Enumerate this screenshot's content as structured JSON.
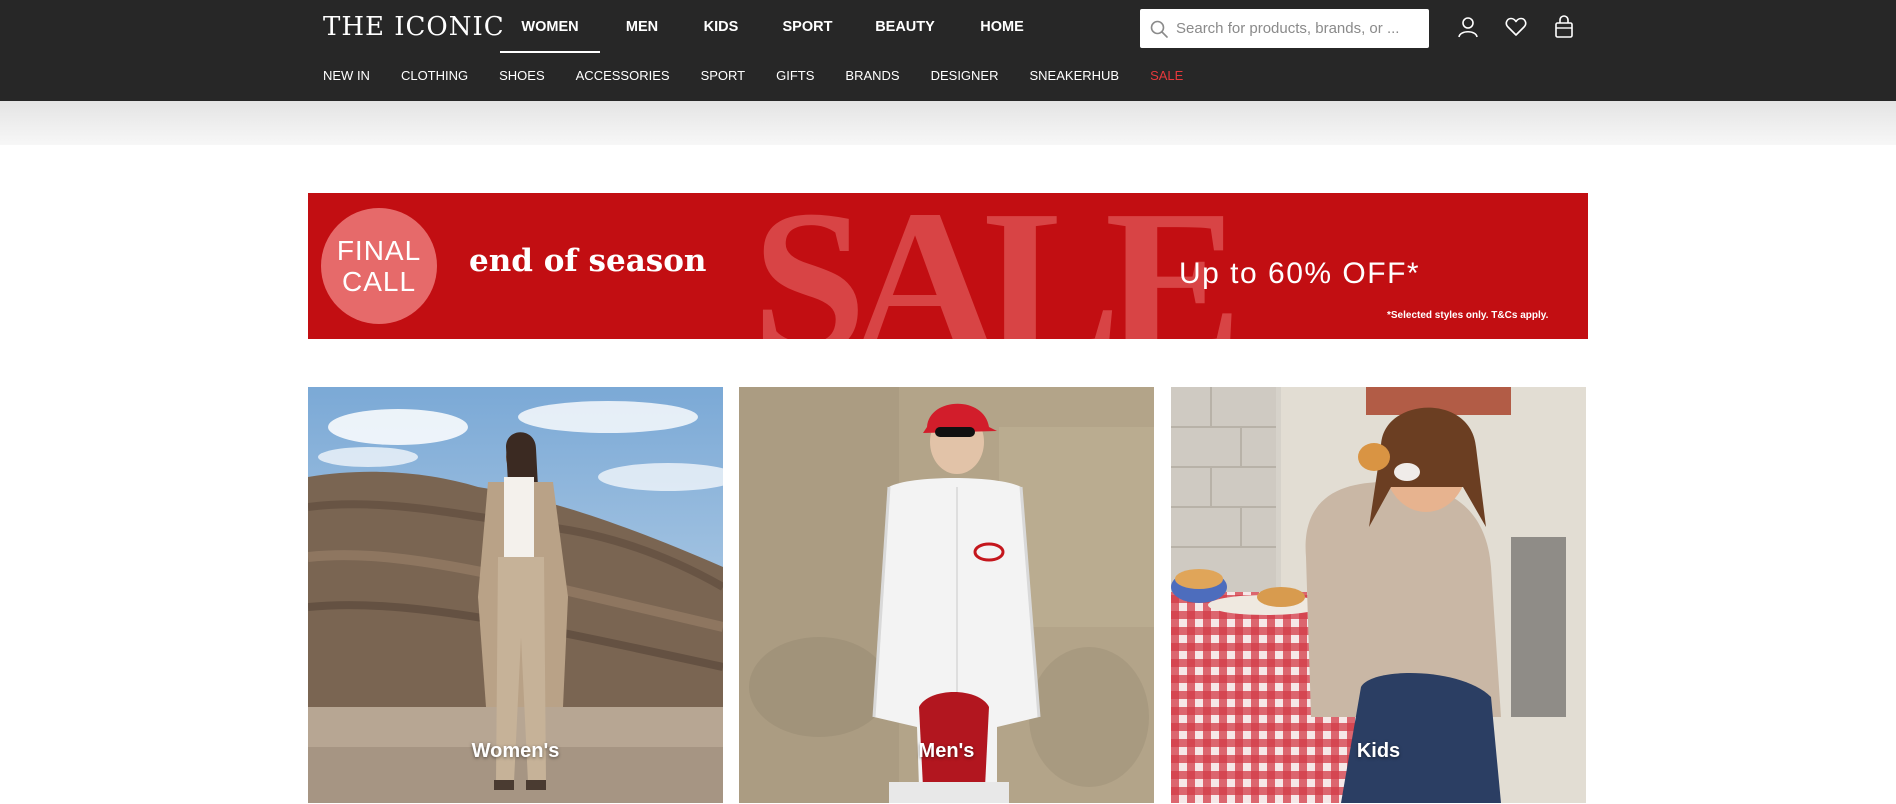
{
  "header": {
    "logo": "THE ICONIC",
    "tabs": [
      {
        "label": "WOMEN",
        "active": true
      },
      {
        "label": "MEN",
        "active": false
      },
      {
        "label": "KIDS",
        "active": false
      },
      {
        "label": "SPORT",
        "active": false
      },
      {
        "label": "BEAUTY",
        "active": false
      },
      {
        "label": "HOME",
        "active": false
      }
    ],
    "search": {
      "placeholder": "Search for products, brands, or ..."
    },
    "icons": [
      "account-icon",
      "wishlist-heart-icon",
      "shopping-bag-icon"
    ]
  },
  "subnav": {
    "items": [
      "NEW IN",
      "CLOTHING",
      "SHOES",
      "ACCESSORIES",
      "SPORT",
      "GIFTS",
      "BRANDS",
      "DESIGNER",
      "SNEAKERHUB",
      "SALE"
    ]
  },
  "banner": {
    "badge_line1": "FINAL",
    "badge_line2": "CALL",
    "subtitle": "end of season",
    "headline": "SALE",
    "offer": "Up to 60% OFF*",
    "terms": "*Selected styles only. T&Cs apply."
  },
  "categories": [
    {
      "label": "Women's"
    },
    {
      "label": "Men's"
    },
    {
      "label": "Kids"
    }
  ],
  "colors": {
    "header_bg": "#272727",
    "banner_red": "#c20e12",
    "sale_link": "#e5393c"
  }
}
